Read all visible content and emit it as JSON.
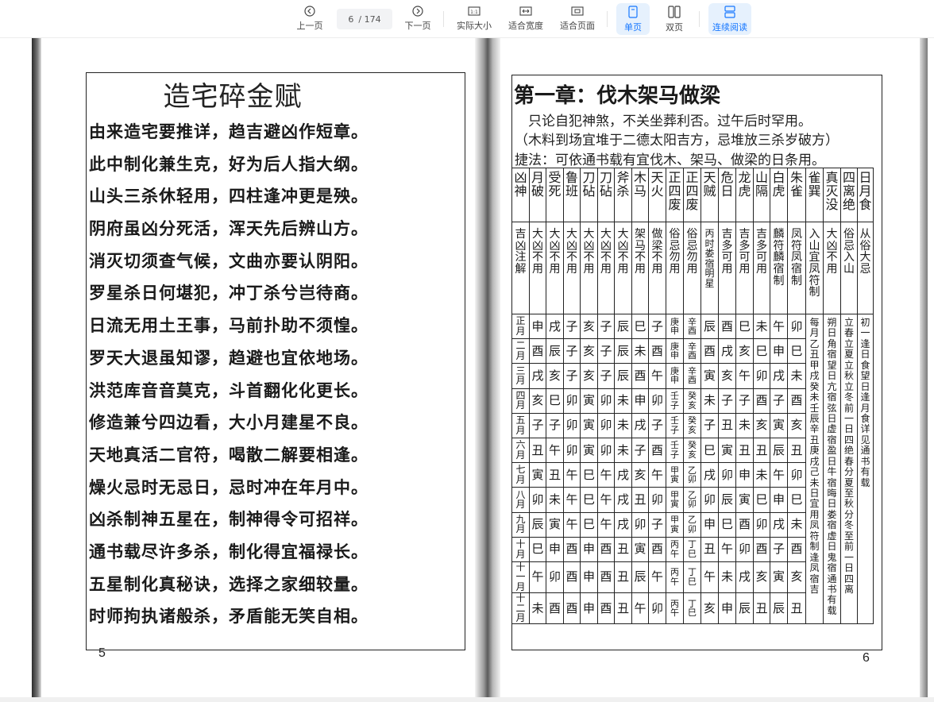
{
  "toolbar": {
    "prev_label": "上一页",
    "page_current": "6",
    "page_total": "/ 174",
    "next_label": "下一页",
    "actual_size_label": "实际大小",
    "fit_width_label": "适合宽度",
    "fit_page_label": "适合页面",
    "single_page_label": "单页",
    "double_page_label": "双页",
    "continuous_label": "连续阅读"
  },
  "left_page": {
    "title": "造宅碎金赋",
    "lines": [
      "由来造宅要推详，趋吉避凶作短章。",
      "此中制化兼生克，好为后人指大纲。",
      "山头三杀休轻用，四柱逢冲更是殃。",
      "阴府虽凶分死活，浑天先后辨山方。",
      "消灭切须查气候，文曲亦要认阴阳。",
      "罗星杀日何堪犯，冲丁杀兮岂待商。",
      "日流无用土王事，马前扑助不须惶。",
      "罗天大退虽知谬，趋避也宜依地场。",
      "洪范库音音莫克，斗首翻化化更长。",
      "修造兼兮四边看，大小月建星不良。",
      "天地真活二官符，喝散二解要相逢。",
      "燥火忌时无忌日，忌时冲在年月中。",
      "凶杀制神五星在，制神得令可招祥。",
      "通书载尽许多杀，制化得宜福禄长。",
      "五星制化真秘诀，选择之家细较量。",
      "时师拘执诸般杀，矛盾能无笑自相。"
    ],
    "page_number": "5"
  },
  "right_page": {
    "title": "第一章：伐木架马做梁",
    "line1": "只论自犯神煞，不关坐葬利否。过午后时罕用。",
    "line2": "（木料到场宜堆于二德太阳吉方，忌堆放三杀岁破方）",
    "line3": "捷法：可依通书载有宜伐木、架马、做梁的日条用。",
    "page_number": "6",
    "headers": [
      "凶神",
      "月破",
      "受死",
      "鲁班",
      "刀砧",
      "刀砧",
      "斧杀",
      "木马",
      "天火",
      "正四废",
      "正四废",
      "天贼",
      "危日",
      "龙虎",
      "山隔",
      "白虎",
      "朱雀",
      "雀巽",
      "真灭没",
      "四离绝",
      "日月食"
    ],
    "notes": [
      "吉凶注解",
      "大凶不用",
      "大凶不用",
      "大凶不用",
      "大凶不用",
      "大凶不用",
      "大凶不用",
      "架马不用",
      "做梁不用",
      "俗忌勿用",
      "俗忌勿用",
      "丙时娄宿明星",
      "吉多可用",
      "吉多可用",
      "吉多可用",
      "麟符麟宿制",
      "凤符凤宿制",
      "入山宜凤符制",
      "大凶不用",
      "俗忌入山",
      "从俗大忌"
    ],
    "months": [
      "正月",
      "二月",
      "三月",
      "四月",
      "五月",
      "六月",
      "七月",
      "八月",
      "九月",
      "十月",
      "十一月",
      "十二月"
    ],
    "rows": [
      [
        "申",
        "戌",
        "子",
        "亥",
        "子",
        "辰",
        "巳",
        "子",
        "庚申",
        "辛酉",
        "辰",
        "酉",
        "巳",
        "未",
        "午",
        "卯"
      ],
      [
        "酉",
        "辰",
        "子",
        "亥",
        "子",
        "辰",
        "未",
        "酉",
        "庚申",
        "辛酉",
        "酉",
        "戌",
        "亥",
        "巳",
        "申",
        "巳"
      ],
      [
        "戌",
        "亥",
        "子",
        "亥",
        "子",
        "辰",
        "酉",
        "午",
        "庚申",
        "辛酉",
        "寅",
        "亥",
        "午",
        "卯",
        "戌",
        "未"
      ],
      [
        "亥",
        "巳",
        "卯",
        "寅",
        "卯",
        "未",
        "申",
        "卯",
        "壬子",
        "癸亥",
        "未",
        "子",
        "子",
        "酉",
        "子",
        "酉"
      ],
      [
        "子",
        "子",
        "卯",
        "寅",
        "卯",
        "未",
        "戌",
        "子",
        "壬子",
        "癸亥",
        "子",
        "丑",
        "未",
        "亥",
        "寅",
        "亥"
      ],
      [
        "丑",
        "午",
        "卯",
        "寅",
        "卯",
        "未",
        "子",
        "酉",
        "壬子",
        "癸亥",
        "巳",
        "寅",
        "丑",
        "丑",
        "辰",
        "丑"
      ],
      [
        "寅",
        "丑",
        "午",
        "巳",
        "午",
        "戌",
        "亥",
        "午",
        "甲寅",
        "乙卯",
        "戌",
        "卯",
        "申",
        "未",
        "午",
        "卯"
      ],
      [
        "卯",
        "未",
        "午",
        "巳",
        "午",
        "戌",
        "丑",
        "卯",
        "甲寅",
        "乙卯",
        "卯",
        "辰",
        "寅",
        "巳",
        "申",
        "巳"
      ],
      [
        "辰",
        "寅",
        "午",
        "巳",
        "午",
        "戌",
        "卯",
        "子",
        "甲寅",
        "乙卯",
        "申",
        "巳",
        "酉",
        "卯",
        "戌",
        "未"
      ],
      [
        "巳",
        "申",
        "酉",
        "申",
        "酉",
        "丑",
        "寅",
        "酉",
        "丙午",
        "丁巳",
        "丑",
        "午",
        "卯",
        "酉",
        "子",
        "酉"
      ],
      [
        "午",
        "卯",
        "酉",
        "申",
        "酉",
        "丑",
        "辰",
        "午",
        "丙午",
        "丁巳",
        "午",
        "未",
        "戌",
        "亥",
        "寅",
        "亥"
      ],
      [
        "未",
        "酉",
        "酉",
        "申",
        "酉",
        "丑",
        "午",
        "卯",
        "丙午",
        "丁巳",
        "亥",
        "申",
        "辰",
        "丑",
        "辰",
        "丑"
      ]
    ],
    "col_queyun": "每月乙丑甲戌癸未壬辰辛丑庚戌己未日宜用凤符制逢凤宿吉",
    "col_miemo": "朔日角宿望日亢宿弦日虚宿盈日牛宿晦日娄宿虚日鬼宿通书有载",
    "col_lijue": "立春立夏立秋立冬前一日四绝春分夏至秋分冬至前一日四离",
    "col_rishi": "初一逢日食望日逢月食详见通书有载"
  }
}
